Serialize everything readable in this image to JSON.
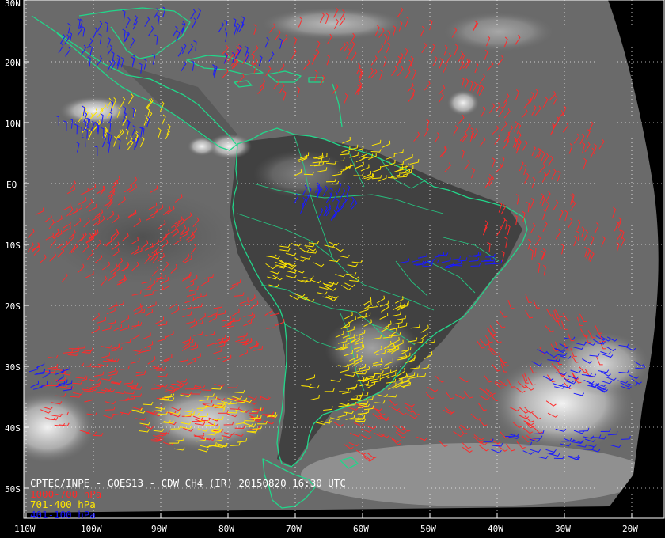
{
  "product": {
    "title_line": "CPTEC/INPE - GOES13 - CDW CH4 (IR) 20150820 16:30 UTC"
  },
  "legend": [
    {
      "label": "1000-700 hPa",
      "color": "#ff2a2a"
    },
    {
      "label": "701-400 hPa",
      "color": "#ffe600"
    },
    {
      "label": "401-100 hPa",
      "color": "#1a1aff"
    }
  ],
  "colors": {
    "coastline": "#22d68a",
    "grid": "#ffffff",
    "background": "#000000",
    "imagery_mid": "#6e6e6e"
  },
  "grid": {
    "latitudes": [
      "30N",
      "20N",
      "10N",
      "EQ",
      "10S",
      "20S",
      "30S",
      "40S",
      "50S"
    ],
    "longitudes": [
      "110W",
      "100W",
      "90W",
      "80W",
      "70W",
      "60W",
      "50W",
      "40W",
      "30W",
      "20W"
    ]
  }
}
